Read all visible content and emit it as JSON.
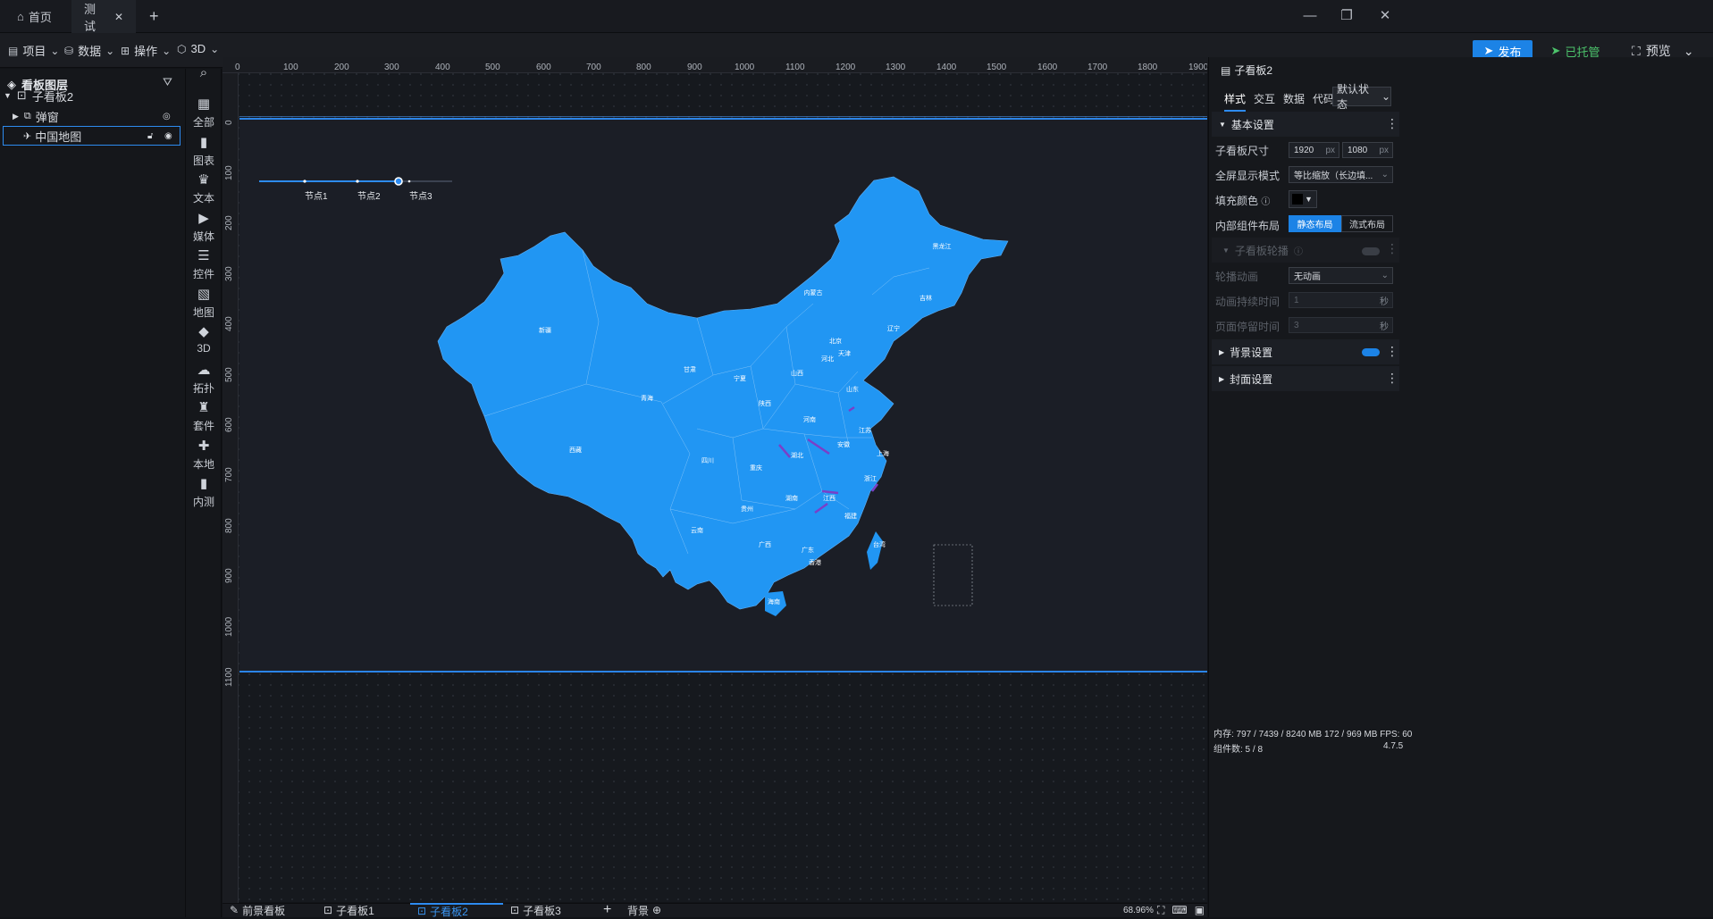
{
  "tabs": [
    {
      "label": "首页",
      "icon": "home-icon"
    },
    {
      "label": "测试",
      "icon": "close-icon"
    }
  ],
  "toolbar": {
    "menus": [
      "项目",
      "数据",
      "操作",
      "3D"
    ],
    "publish": "发布",
    "hosted": "已托管",
    "preview": "预览"
  },
  "layers": {
    "title": "看板图层",
    "items": [
      "子看板2",
      "弹窗",
      "中国地图"
    ]
  },
  "components": [
    "全部",
    "图表",
    "文本",
    "媒体",
    "控件",
    "地图",
    "3D",
    "拓扑",
    "套件",
    "本地",
    "内测"
  ],
  "ruler": {
    "h": [
      "0",
      "100",
      "200",
      "300",
      "400",
      "500",
      "600",
      "700",
      "800",
      "900",
      "1000",
      "1100",
      "1200",
      "1300",
      "1400",
      "1500",
      "1600",
      "1700",
      "1800",
      "1900"
    ],
    "v": [
      "0",
      "100",
      "200",
      "300",
      "400",
      "500",
      "600",
      "700",
      "800",
      "900",
      "1000",
      "1100"
    ]
  },
  "timeline": {
    "nodes": [
      "节点1",
      "节点2",
      "节点3"
    ],
    "active_fraction": 0.72
  },
  "map": {
    "provinces": [
      "新疆",
      "西藏",
      "青海",
      "甘肃",
      "内蒙古",
      "黑龙江",
      "吉林",
      "辽宁",
      "北京",
      "天津",
      "河北",
      "山西",
      "宁夏",
      "陕西",
      "山东",
      "河南",
      "江苏",
      "安徽",
      "上海",
      "湖北",
      "四川",
      "重庆",
      "浙江",
      "湖南",
      "江西",
      "贵州",
      "云南",
      "广西",
      "广东",
      "福建",
      "台湾",
      "香港",
      "海南"
    ],
    "fill": "#2196f3"
  },
  "bottom_tabs": [
    "前景看板",
    "子看板1",
    "子看板2",
    "子看板3",
    "背景"
  ],
  "zoom": "68.96%",
  "right": {
    "title": "子看板2",
    "tabs": [
      "样式",
      "交互",
      "数据",
      "代码"
    ],
    "state": "默认状态",
    "basic": "基本设置",
    "size_label": "子看板尺寸",
    "width": "1920",
    "height": "1080",
    "unit": "px",
    "fullscreen_label": "全屏显示模式",
    "fullscreen_value": "等比缩放（长边填...",
    "fill_label": "填充颜色",
    "layout_label": "内部组件布局",
    "layout_static": "静态布局",
    "layout_flow": "流式布局",
    "carousel": "子看板轮播",
    "anim_label": "轮播动画",
    "anim_value": "无动画",
    "duration_label": "动画持续时间",
    "duration_value": "1",
    "stay_label": "页面停留时间",
    "stay_value": "3",
    "sec": "秒",
    "bg": "背景设置",
    "cover": "封面设置"
  },
  "status": {
    "memory": "内存:  797 / 7439 / 8240 MB  172 / 969 MB  FPS:  60",
    "count": "组件数: 5 / 8",
    "version": "4.7.5"
  },
  "colors": {
    "accent": "#1c83e6",
    "map": "#2196f3",
    "hosted": "#4cc36b"
  }
}
